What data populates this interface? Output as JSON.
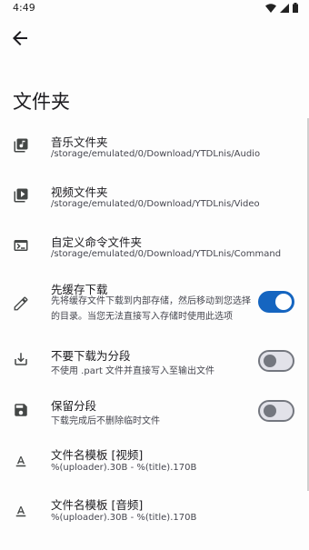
{
  "status": {
    "time": "4:49"
  },
  "page": {
    "title": "文件夹"
  },
  "settings": [
    {
      "title": "音乐文件夹",
      "subtitle": "/storage/emulated/0/Download/YTDLnis/Audio"
    },
    {
      "title": "视频文件夹",
      "subtitle": "/storage/emulated/0/Download/YTDLnis/Video"
    },
    {
      "title": "自定义命令文件夹",
      "subtitle": "/storage/emulated/0/Download/YTDLnis/Command"
    },
    {
      "title": "先缓存下载",
      "subtitle": "先将缓存文件下载到内部存储，然后移动到您选择的目录。当您无法直接写入存储时使用此选项",
      "toggle": true
    },
    {
      "title": "不要下载为分段",
      "subtitle": "不使用 .part 文件并直接写入至输出文件",
      "toggle": false
    },
    {
      "title": "保留分段",
      "subtitle": "下载完成后不删除临时文件",
      "toggle": false
    },
    {
      "title": "文件名模板 [视频]",
      "subtitle": "%(uploader).30B - %(title).170B"
    },
    {
      "title": "文件名模板 [音频]",
      "subtitle": "%(uploader).30B - %(title).170B"
    }
  ],
  "colors": {
    "accent": "#1565c0",
    "icon": "#444746"
  },
  "icons": [
    "music-folder-icon",
    "video-folder-icon",
    "terminal-icon",
    "pencil-icon",
    "download-icon",
    "save-icon",
    "text-format-icon",
    "text-format-icon"
  ]
}
